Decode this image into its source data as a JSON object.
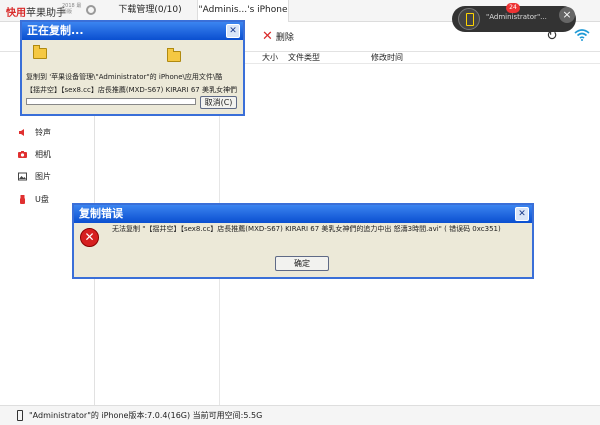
{
  "app": {
    "logo_red": "快用",
    "logo_text": "苹果助手",
    "version": "2018 最新版"
  },
  "tabs": {
    "download": "下载管理(0/10)",
    "device": "\"Adminis...'s iPhone"
  },
  "toolbar": {
    "delete_label": "删除"
  },
  "device_popup": {
    "name": "\"Administrator\"...",
    "badge": "24"
  },
  "columns": {
    "size": "大小",
    "type": "文件类型",
    "modified": "修改时间"
  },
  "sidebar": {
    "items": [
      {
        "label": "铃声",
        "icon": "bell-icon",
        "color": "#e03030"
      },
      {
        "label": "相机",
        "icon": "camera-icon",
        "color": "#e03030"
      },
      {
        "label": "图片",
        "icon": "image-icon",
        "color": "#444444"
      },
      {
        "label": "U盘",
        "icon": "usb-icon",
        "color": "#e03030"
      }
    ]
  },
  "copy_dialog": {
    "title": "正在复制...",
    "line1": "复制到 '苹果设备管理\\\"Administrator\"的 iPhone\\应用文件\\酷",
    "line2": "【揺井空】【sex8.cc】店長推薦(MXD-S67) KIRARI 67 美乳女神們",
    "cancel_label": "取消(C)"
  },
  "error_dialog": {
    "title": "复制错误",
    "message": "无法复制 \"【揺井空】【sex8.cc】店長推薦(MXD-S67) KIRARI 67 美乳女神們的追力中出 怒濤3時間.avi\" ( 错误码 0xc351)",
    "ok_label": "确定"
  },
  "statusbar": {
    "device": "\"Administrator\"的 iPhone",
    "info": "版本:7.0.4(16G) 当前可用空间:5.5G"
  },
  "colors": {
    "accent": "#d92b2b",
    "xp_blue": "#0a4fd0",
    "wifi": "#1f9ad6"
  }
}
